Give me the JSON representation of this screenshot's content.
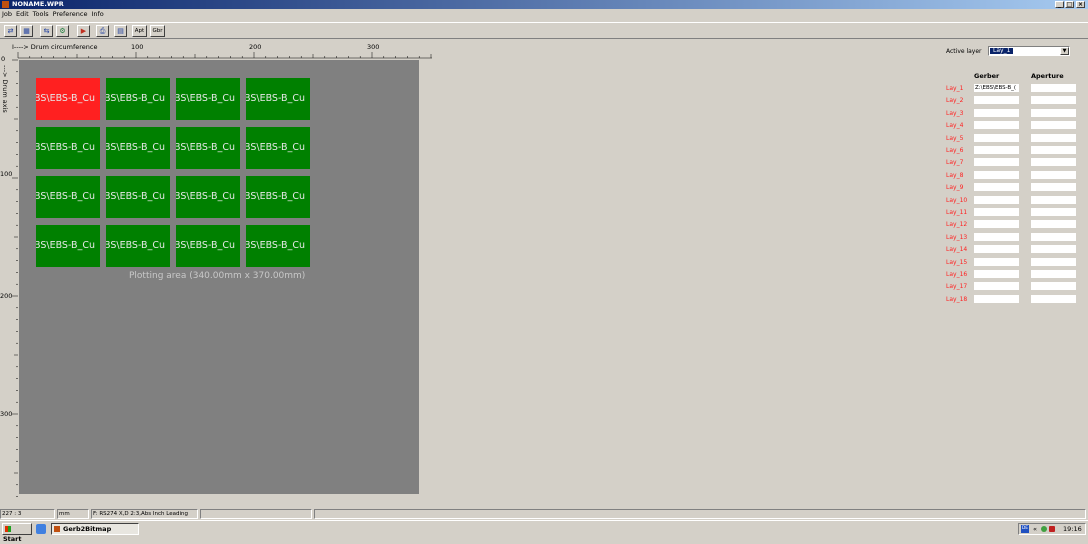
{
  "window": {
    "title": "NONAME.WPR",
    "controls": [
      "_",
      "□",
      "×"
    ],
    "icon": "app-icon"
  },
  "menu": [
    "Job",
    "Edit",
    "Tools",
    "Preference",
    "Info"
  ],
  "toolbar": {
    "buttons": [
      {
        "name": "add-layer-icon",
        "glyph": "⇄"
      },
      {
        "name": "grid-view-icon",
        "glyph": "▦"
      },
      {
        "name": "swap-icon",
        "glyph": "⇆"
      },
      {
        "name": "settings-icon",
        "glyph": "⚙"
      },
      {
        "name": "export-icon",
        "glyph": "▶"
      },
      {
        "name": "print-icon",
        "glyph": "⎙"
      },
      {
        "name": "calendar-icon",
        "glyph": "▤"
      }
    ],
    "apt_label": "Apt",
    "gbr_label": "Gbr"
  },
  "ruler": {
    "top_label": "I----> Drum circumference",
    "top_ticks": [
      "0",
      "100",
      "200",
      "300"
    ],
    "left_label": "---> Drum axis",
    "left_ticks": [
      "100",
      "200",
      "300"
    ]
  },
  "canvas": {
    "tile_label": "BS\\EBS-B_Cu",
    "tiles": [
      [
        "red",
        "green",
        "green",
        "green"
      ],
      [
        "green",
        "green",
        "green",
        "green"
      ],
      [
        "green",
        "green",
        "green",
        "green"
      ],
      [
        "green",
        "green",
        "green",
        "green"
      ]
    ],
    "plot_area_label": "Plotting area (340.00mm x 370.00mm)"
  },
  "right_panel": {
    "active_layer_label": "Active layer",
    "active_layer_value": "Lay_1",
    "gerber_header": "Gerber",
    "aperture_header": "Aperture",
    "layers": [
      {
        "name": "Lay_1",
        "gerber": "Z:\\EBS\\EBS-B_(",
        "aperture": ""
      },
      {
        "name": "Lay_2",
        "gerber": "",
        "aperture": ""
      },
      {
        "name": "Lay_3",
        "gerber": "",
        "aperture": ""
      },
      {
        "name": "Lay_4",
        "gerber": "",
        "aperture": ""
      },
      {
        "name": "Lay_5",
        "gerber": "",
        "aperture": ""
      },
      {
        "name": "Lay_6",
        "gerber": "",
        "aperture": ""
      },
      {
        "name": "Lay_7",
        "gerber": "",
        "aperture": ""
      },
      {
        "name": "Lay_8",
        "gerber": "",
        "aperture": ""
      },
      {
        "name": "Lay_9",
        "gerber": "",
        "aperture": ""
      },
      {
        "name": "Lay_10",
        "gerber": "",
        "aperture": ""
      },
      {
        "name": "Lay_11",
        "gerber": "",
        "aperture": ""
      },
      {
        "name": "Lay_12",
        "gerber": "",
        "aperture": ""
      },
      {
        "name": "Lay_13",
        "gerber": "",
        "aperture": ""
      },
      {
        "name": "Lay_14",
        "gerber": "",
        "aperture": ""
      },
      {
        "name": "Lay_15",
        "gerber": "",
        "aperture": ""
      },
      {
        "name": "Lay_16",
        "gerber": "",
        "aperture": ""
      },
      {
        "name": "Lay_17",
        "gerber": "",
        "aperture": ""
      },
      {
        "name": "Lay_18",
        "gerber": "",
        "aperture": ""
      }
    ]
  },
  "status": {
    "coords": "227 : 3",
    "unit": "mm",
    "format": "F: RS274 X,D 2:3,Abs Inch Leading",
    "empty1": "",
    "empty2": ""
  },
  "taskbar": {
    "start_label": "Start",
    "task_label": "Gerb2Bitmap",
    "clock": "19:16",
    "tray_lang": "DE",
    "tray_chevron": "«"
  },
  "colors": {
    "tile_active": "#ff2020",
    "tile_inactive": "#008000",
    "canvas": "#808080",
    "layer_label": "#ff2020",
    "titlebar": "#0a246a"
  }
}
